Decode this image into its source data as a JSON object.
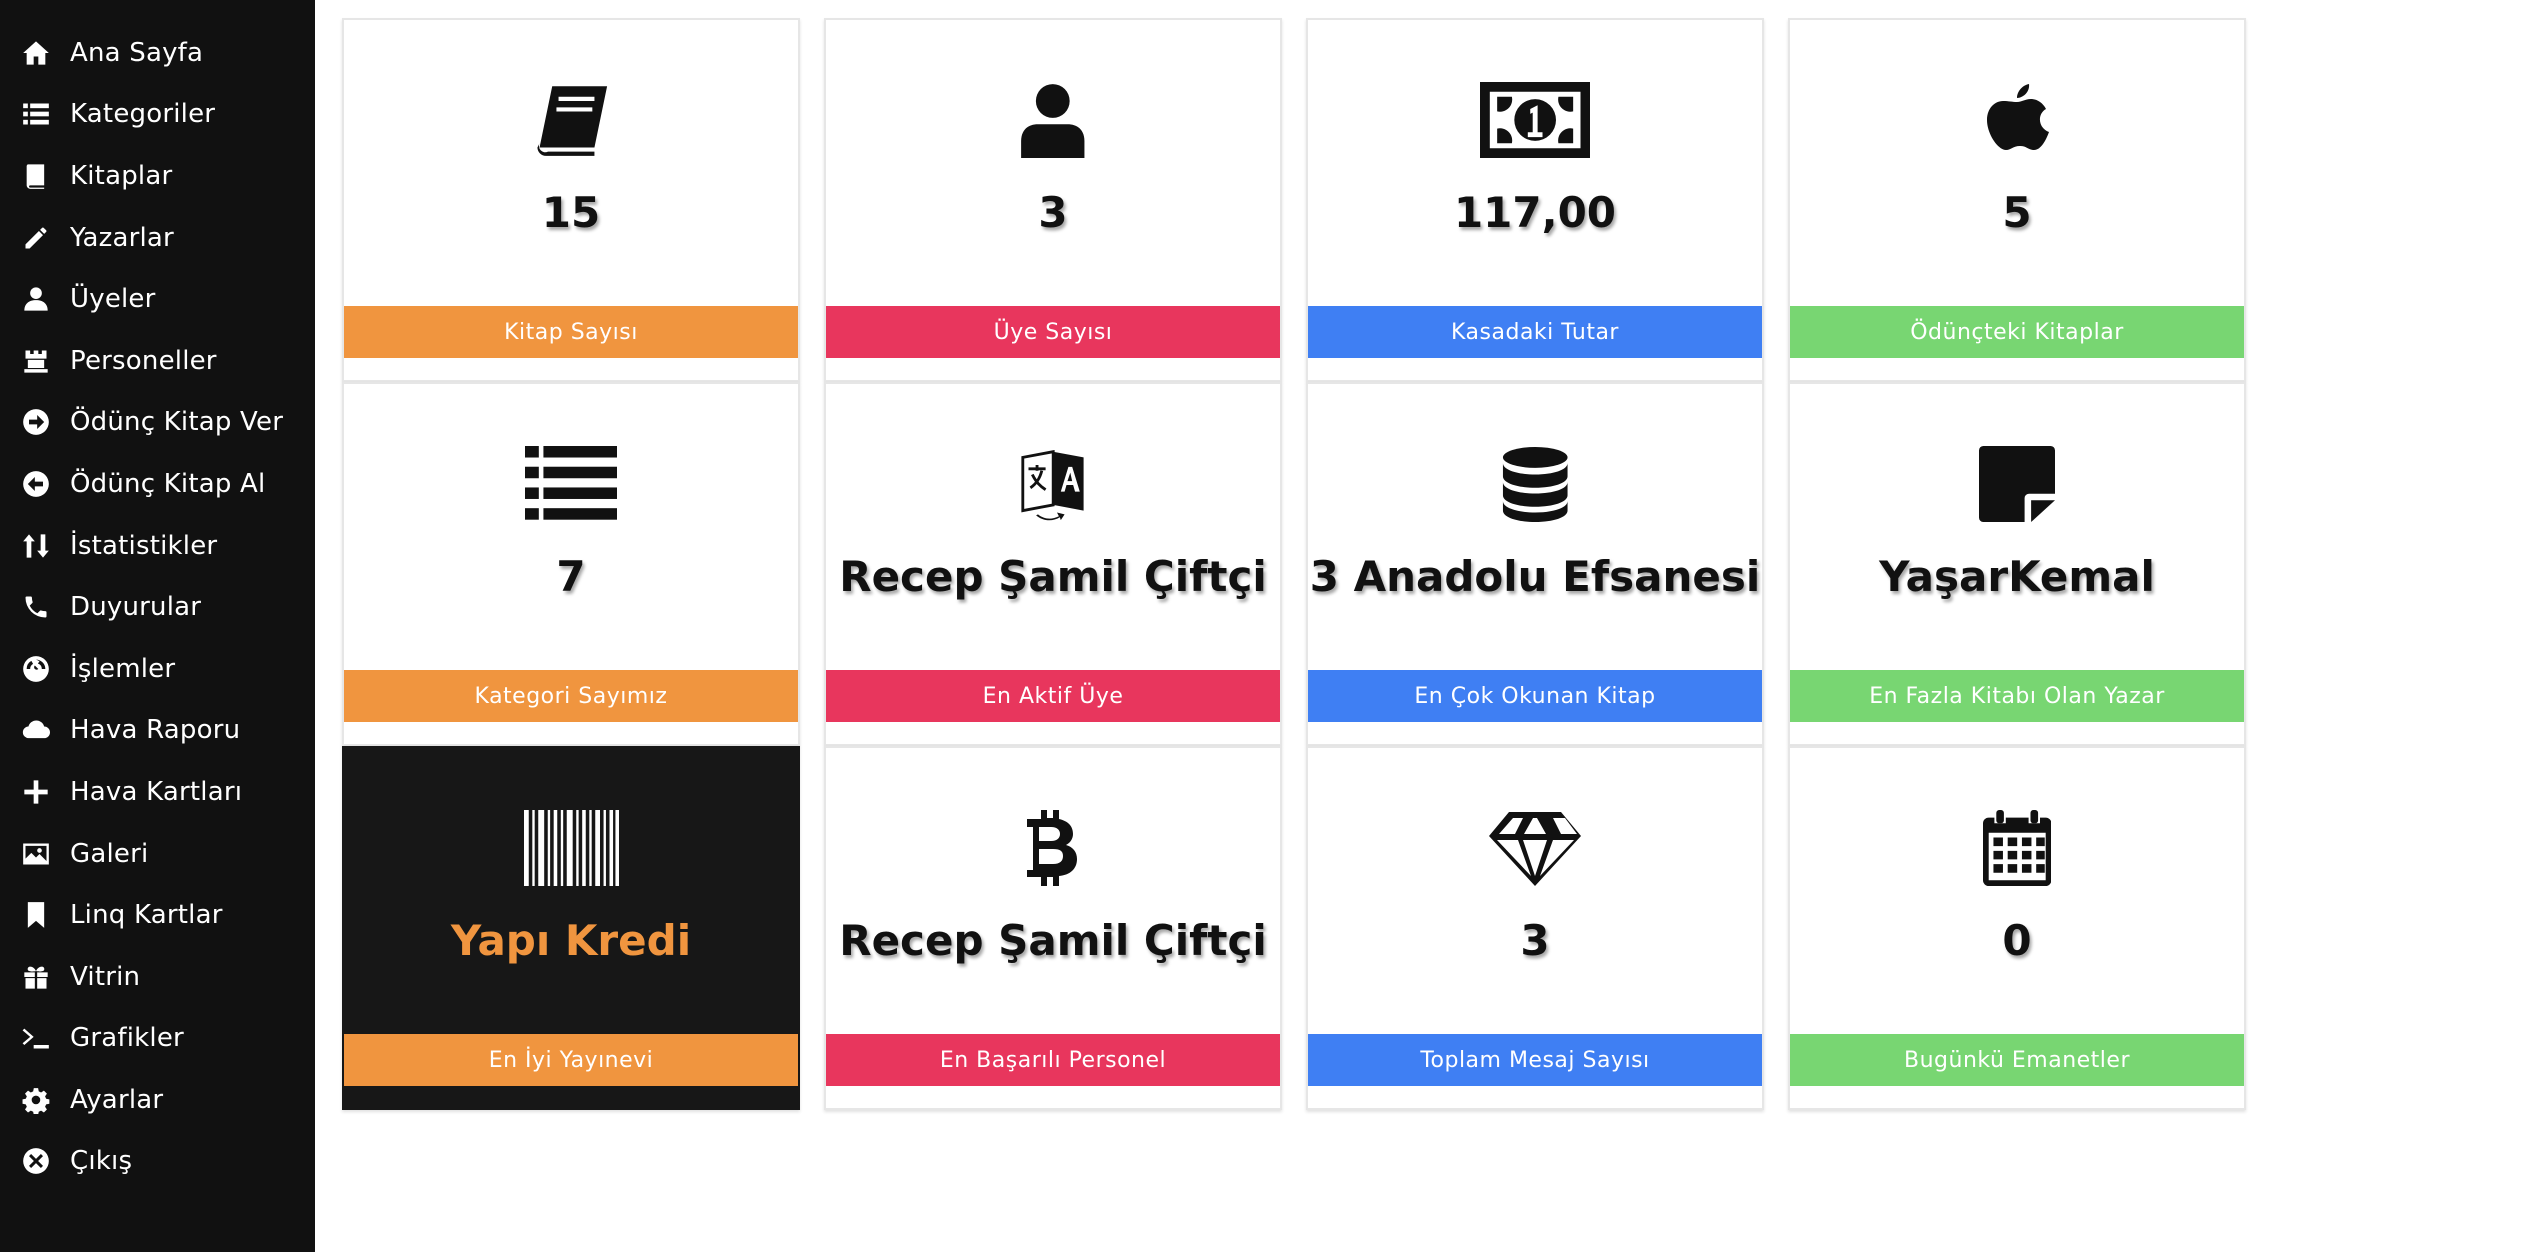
{
  "colors": {
    "sidebar_bg": "#111111",
    "orange": "#f0953f",
    "red": "#e8365d",
    "blue": "#3f7ff3",
    "green": "#78d672",
    "dark_card": "#171717"
  },
  "sidebar": {
    "items": [
      {
        "label": "Ana Sayfa",
        "icon": "home-icon"
      },
      {
        "label": "Kategoriler",
        "icon": "list-icon"
      },
      {
        "label": "Kitaplar",
        "icon": "book-icon"
      },
      {
        "label": "Yazarlar",
        "icon": "pencil-icon"
      },
      {
        "label": "Üyeler",
        "icon": "user-icon"
      },
      {
        "label": "Personeller",
        "icon": "tower-icon"
      },
      {
        "label": "Ödünç Kitap Ver",
        "icon": "arrow-circle-right-icon"
      },
      {
        "label": "Ödünç Kitap Al",
        "icon": "arrow-circle-left-icon"
      },
      {
        "label": "İstatistikler",
        "icon": "sort-icon"
      },
      {
        "label": "Duyurular",
        "icon": "phone-icon"
      },
      {
        "label": "İşlemler",
        "icon": "dashboard-icon"
      },
      {
        "label": "Hava Raporu",
        "icon": "cloud-icon"
      },
      {
        "label": "Hava Kartları",
        "icon": "plus-icon"
      },
      {
        "label": "Galeri",
        "icon": "image-icon"
      },
      {
        "label": "Linq Kartlar",
        "icon": "bookmark-icon"
      },
      {
        "label": "Vitrin",
        "icon": "gift-icon"
      },
      {
        "label": "Grafikler",
        "icon": "terminal-icon"
      },
      {
        "label": "Ayarlar",
        "icon": "gear-icon"
      },
      {
        "label": "Çıkış",
        "icon": "close-circle-icon"
      }
    ]
  },
  "cards": [
    {
      "value": "15",
      "label": "Kitap Sayısı",
      "icon": "book-icon",
      "color": "orange"
    },
    {
      "value": "3",
      "label": "Üye Sayısı",
      "icon": "user-icon",
      "color": "red"
    },
    {
      "value": "117,00",
      "label": "Kasadaki Tutar",
      "icon": "money-icon",
      "color": "blue"
    },
    {
      "value": "5",
      "label": "Ödünçteki Kitaplar",
      "icon": "apple-icon",
      "color": "green"
    },
    {
      "value": "7",
      "label": "Kategori Sayımız",
      "icon": "list-icon",
      "color": "orange"
    },
    {
      "value": "Recep Şamil Çiftçi",
      "label": "En Aktif Üye",
      "icon": "translate-icon",
      "color": "red"
    },
    {
      "value": "3 Anadolu Efsanesi",
      "label": "En Çok Okunan Kitap",
      "icon": "database-icon",
      "color": "blue"
    },
    {
      "value": "YaşarKemal",
      "label": "En Fazla Kitabı Olan Yazar",
      "icon": "sticky-note-icon",
      "color": "green"
    },
    {
      "value": "Yapı Kredi",
      "label": "En İyi Yayınevi",
      "icon": "barcode-icon",
      "color": "orange"
    },
    {
      "value": "Recep Şamil Çiftçi",
      "label": "En Başarılı Personel",
      "icon": "bitcoin-icon",
      "color": "red"
    },
    {
      "value": "3",
      "label": "Toplam Mesaj Sayısı",
      "icon": "diamond-icon",
      "color": "blue"
    },
    {
      "value": "0",
      "label": "Bugünkü Emanetler",
      "icon": "calendar-icon",
      "color": "green"
    }
  ]
}
